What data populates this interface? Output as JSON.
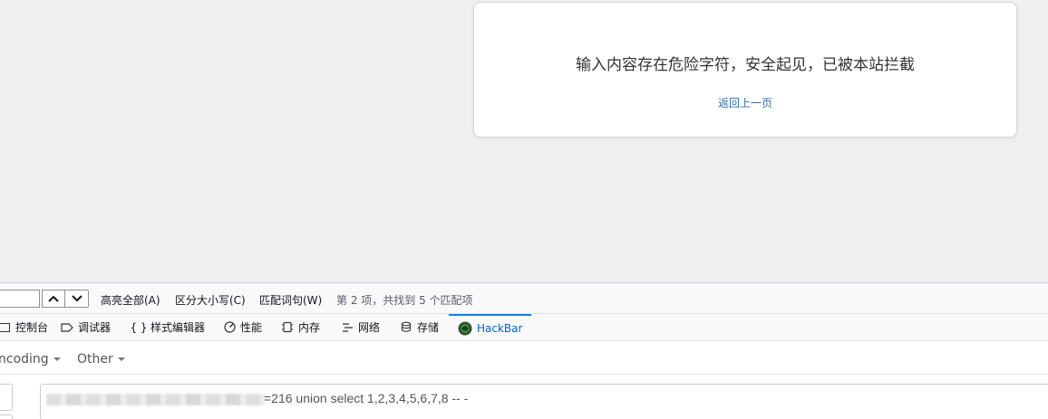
{
  "page": {
    "alert_message": "输入内容存在危险字符，安全起见，已被本站拦截",
    "back_link": "返回上一页"
  },
  "findbar": {
    "search_value": "",
    "highlight_all": "高亮全部(A)",
    "match_case": "区分大小写(C)",
    "whole_words": "匹配词句(W)",
    "status": "第 2 项，共找到 5 个匹配项"
  },
  "devtools": {
    "tabs": [
      {
        "label": "控制台",
        "icon": "console-icon"
      },
      {
        "label": "调试器",
        "icon": "debugger-icon"
      },
      {
        "label": "样式编辑器",
        "icon": "braces-icon"
      },
      {
        "label": "性能",
        "icon": "performance-icon"
      },
      {
        "label": "内存",
        "icon": "memory-icon"
      },
      {
        "label": "网络",
        "icon": "network-icon"
      },
      {
        "label": "存储",
        "icon": "storage-icon"
      },
      {
        "label": "HackBar",
        "icon": "hackbar-icon",
        "active": true
      }
    ],
    "accent_color": "#0a84ff"
  },
  "hackbar": {
    "menus": [
      "ncoding",
      "Other"
    ],
    "url_value": "=216 union select 1,2,3,4,5,6,7,8 -- -"
  }
}
